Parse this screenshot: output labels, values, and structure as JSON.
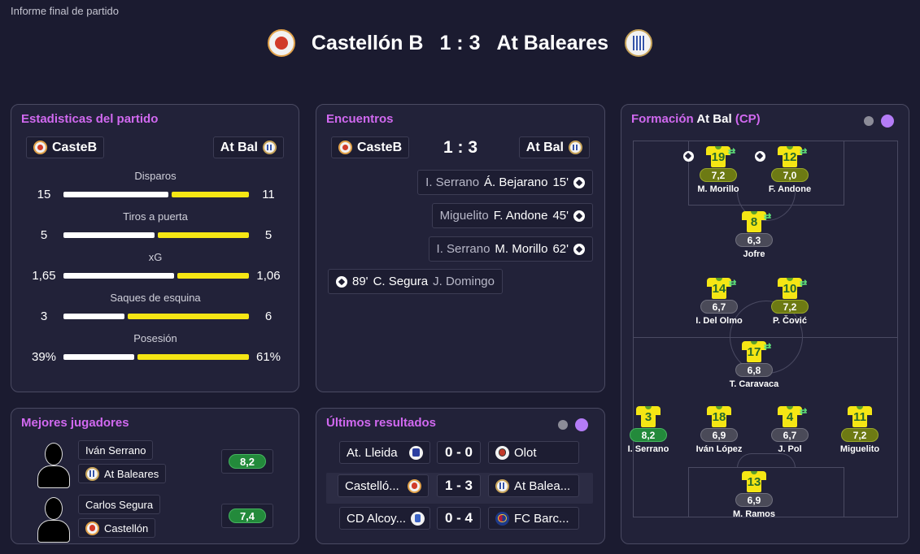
{
  "header": {
    "supertitle": "Informe final de partido",
    "home_team": "Castellón B",
    "score": "1 : 3",
    "away_team": "At Baleares"
  },
  "stats": {
    "title": "Estadisticas del partido",
    "home_label": "CasteB",
    "away_label": "At Bal",
    "rows": [
      {
        "name": "Disparos",
        "home": "15",
        "away": "11",
        "home_fraction": 0.577
      },
      {
        "name": "Tiros a puerta",
        "home": "5",
        "away": "5",
        "home_fraction": 0.5
      },
      {
        "name": "xG",
        "home": "1,65",
        "away": "1,06",
        "home_fraction": 0.609
      },
      {
        "name": "Saques de esquina",
        "home": "3",
        "away": "6",
        "home_fraction": 0.333
      },
      {
        "name": "Posesión",
        "home": "39%",
        "away": "61%",
        "home_fraction": 0.39
      }
    ],
    "colors": {
      "home": "#ffffff",
      "away": "#f5e614"
    }
  },
  "events": {
    "title": "Encuentros",
    "home_label": "CasteB",
    "score": "1 : 3",
    "away_label": "At Bal",
    "items": [
      {
        "assist": "I. Serrano",
        "scorer": "Á. Bejarano",
        "minute": "15'"
      },
      {
        "assist": "Miguelito",
        "scorer": "F. Andone",
        "minute": "45'"
      },
      {
        "assist": "I. Serrano",
        "scorer": "M. Morillo",
        "minute": "62'"
      },
      {
        "minute": "89'",
        "scorer": "C. Segura",
        "assist": "J. Domingo"
      }
    ]
  },
  "best_players": {
    "title": "Mejores jugadores",
    "players": [
      {
        "name": "Iván Serrano",
        "team": "At Baleares",
        "rating": "8,2"
      },
      {
        "name": "Carlos Segura",
        "team": "Castellón",
        "rating": "7,4"
      }
    ]
  },
  "results": {
    "title": "Últimos resultados",
    "rows": [
      {
        "home": "At. Lleida",
        "score": "0 - 0",
        "away": "Olot"
      },
      {
        "home": "Castelló...",
        "score": "1 - 3",
        "away": "At Balea..."
      },
      {
        "home": "CD Alcoy...",
        "score": "0 - 4",
        "away": "FC Barc..."
      }
    ]
  },
  "formation": {
    "title_prefix": "Formación",
    "team": "At Bal",
    "tag": "(CP)",
    "players": [
      {
        "number": "19",
        "rating": "7,2",
        "name": "M. Morillo"
      },
      {
        "number": "12",
        "rating": "7,0",
        "name": "F. Andone"
      },
      {
        "number": "8",
        "rating": "6,3",
        "name": "Jofre"
      },
      {
        "number": "14",
        "rating": "6,7",
        "name": "I. Del Olmo"
      },
      {
        "number": "10",
        "rating": "7,2",
        "name": "P. Čović"
      },
      {
        "number": "17",
        "rating": "6,8",
        "name": "T. Caravaca"
      },
      {
        "number": "3",
        "rating": "8,2",
        "name": "I. Serrano"
      },
      {
        "number": "18",
        "rating": "6,9",
        "name": "Iván López"
      },
      {
        "number": "4",
        "rating": "6,7",
        "name": "J. Pol"
      },
      {
        "number": "11",
        "rating": "7,2",
        "name": "Miguelito"
      },
      {
        "number": "13",
        "rating": "6,9",
        "name": "M. Ramos"
      }
    ]
  }
}
